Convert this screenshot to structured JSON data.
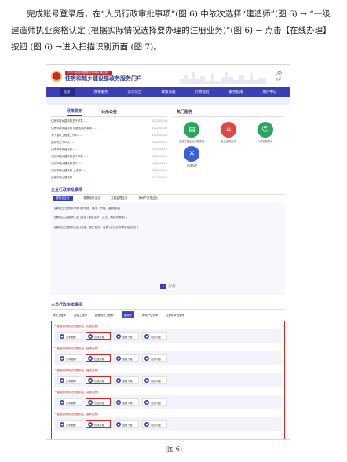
{
  "instructions": "完成账号登录后，在“人员行政审批事项”(图 6) 中依次选择“建造师”(图 6) → “一级建造师执业资格认定 (根据实际情况选择要办理的注册业务)”(图 6) → 点击【在线办理】按钮 (图 6) →进入扫描识别页面 (图 7)。",
  "caption": "(图 6)",
  "portal": {
    "brand_small": "中华人民共和国住房和城乡建设部",
    "brand_main": "住房和城乡建设部政务服务门户",
    "user_label": "个人登录",
    "nav": [
      "首页",
      "办事服务",
      "公示公告",
      "政策法规",
      "行政处罚",
      "服务指南",
      "用户中心"
    ],
    "policy_tabs": [
      "政策发布",
      "公示公告"
    ],
    "policy_items": [
      {
        "title": "住房和城乡建设部关于印发......",
        "date": "2022-05-06"
      },
      {
        "title": "住房和城乡建设部 国家发展改革委......",
        "date": "2022-05-06"
      },
      {
        "title": "关于建筑工程施工许可......",
        "date": "2022-05-05"
      },
      {
        "title": "国务院关于印发......",
        "date": "2022-05-01"
      },
      {
        "title": "住房和城乡建设部......",
        "date": "2022-04-19"
      },
      {
        "title": "住房和城乡建设部关于印发......",
        "date": "2022-04-15"
      },
      {
        "title": "住房和城乡建设部关于......",
        "date": "2022-04-14"
      },
      {
        "title": "住房和城乡建设部 公安部......",
        "date": "2022-04-13"
      },
      {
        "title": "住房和城乡建设部......",
        "date": "2022-04-08"
      }
    ],
    "hot_title": "热门服务",
    "hot_services": [
      {
        "label": "建设工程企业资质查询",
        "color": "#2aa65c",
        "glyph": "▤"
      },
      {
        "label": "企业信用查询",
        "color": "#e04848",
        "glyph": "⌂"
      },
      {
        "label": "人员信用查询",
        "color": "#2aa65c",
        "glyph": "☺"
      },
      {
        "label": "在线办理",
        "color": "#3b5fd8",
        "glyph": "✕"
      }
    ],
    "enterprise_title": "企业行政审批事项",
    "enterprise_tabs": [
      "建筑业企业",
      "勘察设计企业",
      "工程监理企业",
      "房地产开发企业"
    ],
    "enterprise_items": [
      "建筑业企业资质申请 (新申请、增项、升级、重新核定)",
      "建筑业企业资质认定 (延续 (重组合并、分立、跨省变更等) )",
      "建筑业企业资质认定 (变更、遗失补办、注销 (企业名称等信息变更) )"
    ],
    "pager_page": "1",
    "pager_text": "共1页",
    "personnel_title": "人员行政审批事项",
    "personnel_tabs": [
      "造价工程师",
      "监理工程师",
      "勘察设计工程师",
      "建造师",
      "房地产估价师",
      "注册城乡规划师"
    ],
    "active_personnel_tab": "建造师",
    "groups": [
      "一级建造师执业资格认定 (初始注册)",
      "一级建造师执业资格认定 (延续注册)",
      "一级建造师执业资格认定 (增项注册)",
      "一级建造师执业资格认定 (变更注册)",
      "一级建造师执业资格认定 (重新注册)"
    ],
    "group_buttons": [
      "办事指南",
      "在线办理",
      "表格下载",
      "常见问题"
    ]
  }
}
